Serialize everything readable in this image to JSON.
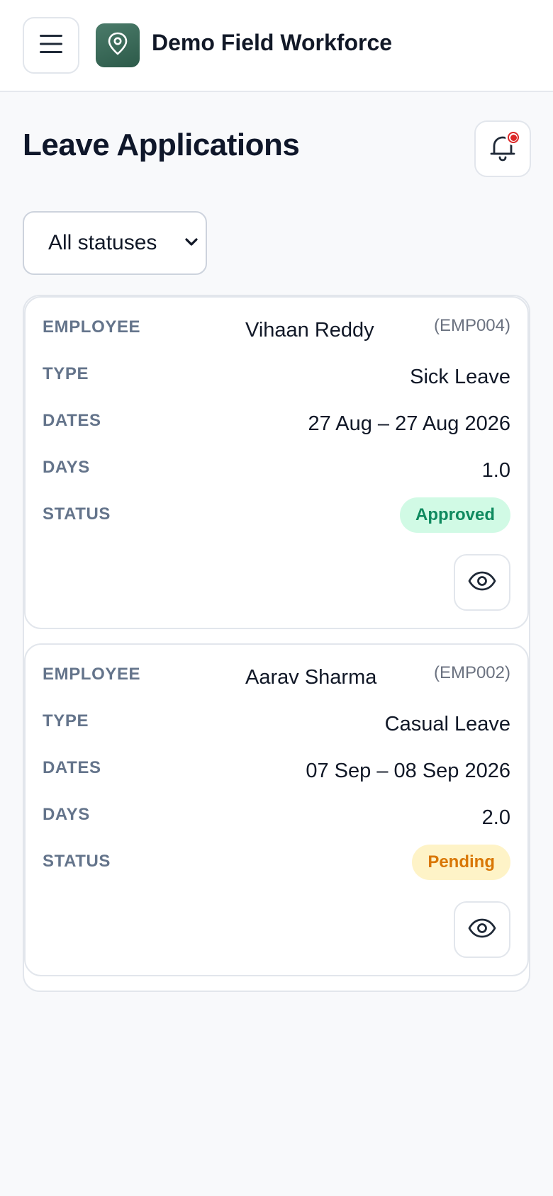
{
  "header": {
    "app_title": "Demo Field Workforce",
    "menu_icon": "hamburger-menu-icon",
    "logo_icon": "location-pin-icon",
    "brand_color": "#2f5f4e"
  },
  "page": {
    "title": "Leave Applications",
    "notification_icon": "bell-icon",
    "notification_dot_color": "#dc2626"
  },
  "filter": {
    "status_selected": "All statuses"
  },
  "labels": {
    "employee": "EMPLOYEE",
    "type": "TYPE",
    "dates": "DATES",
    "days": "DAYS",
    "status": "STATUS"
  },
  "leaves": [
    {
      "employee_name": "Vihaan Reddy",
      "employee_code": "(EMP004)",
      "type": "Sick Leave",
      "dates": "27 Aug – 27 Aug 2026",
      "days": "1.0",
      "status": "Approved",
      "status_color": "#0f8a5f",
      "view_icon": "eye-icon"
    },
    {
      "employee_name": "Aarav Sharma",
      "employee_code": "(EMP002)",
      "type": "Casual Leave",
      "dates": "07 Sep – 08 Sep 2026",
      "days": "2.0",
      "status": "Pending",
      "status_color": "#d97706",
      "view_icon": "eye-icon"
    }
  ]
}
